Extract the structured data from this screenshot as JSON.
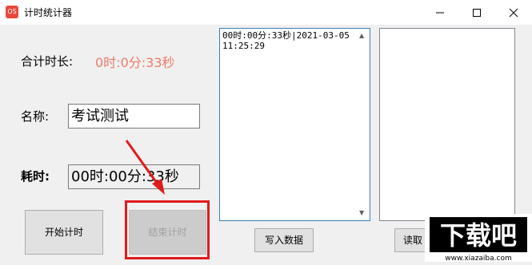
{
  "window": {
    "title": "计时统计器",
    "app_icon_text": "OS",
    "icons": [
      "minimize-icon",
      "maximize-icon",
      "close-icon"
    ]
  },
  "total": {
    "label": "合计时长:",
    "value": "0时:0分:33秒",
    "value_color": "#f07a6a"
  },
  "name": {
    "label": "名称:",
    "value": "考试测试"
  },
  "elapsed": {
    "label": "耗时:",
    "value": "00时:00分:33秒"
  },
  "buttons": {
    "start": "开始计时",
    "end": "结束计时",
    "write": "写入数据",
    "read": "读取"
  },
  "log": {
    "line1": "00时:00分:33秒|2021-03-05",
    "line2": "11:25:29"
  },
  "watermark": {
    "text": "下载吧",
    "url": "www.xiazaiba.com"
  }
}
